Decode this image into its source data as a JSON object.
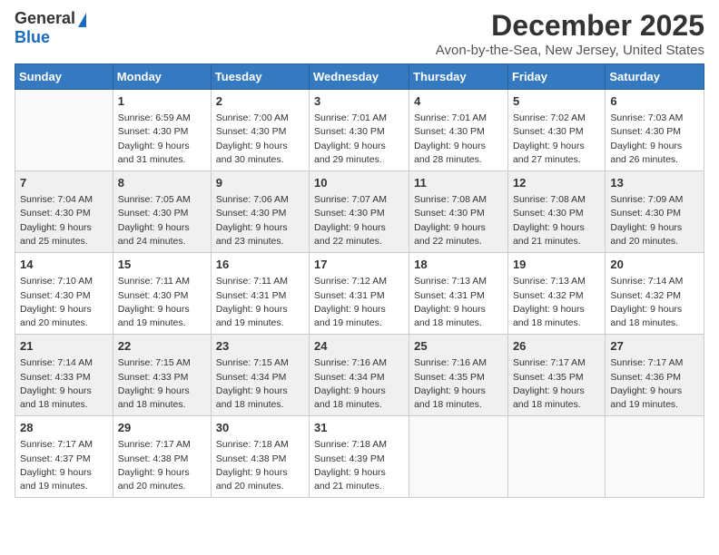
{
  "logo": {
    "line1": "General",
    "line2": "Blue"
  },
  "title": "December 2025",
  "subtitle": "Avon-by-the-Sea, New Jersey, United States",
  "days_of_week": [
    "Sunday",
    "Monday",
    "Tuesday",
    "Wednesday",
    "Thursday",
    "Friday",
    "Saturday"
  ],
  "weeks": [
    [
      {
        "day": "",
        "sunrise": "",
        "sunset": "",
        "daylight": ""
      },
      {
        "day": "1",
        "sunrise": "Sunrise: 6:59 AM",
        "sunset": "Sunset: 4:30 PM",
        "daylight": "Daylight: 9 hours and 31 minutes."
      },
      {
        "day": "2",
        "sunrise": "Sunrise: 7:00 AM",
        "sunset": "Sunset: 4:30 PM",
        "daylight": "Daylight: 9 hours and 30 minutes."
      },
      {
        "day": "3",
        "sunrise": "Sunrise: 7:01 AM",
        "sunset": "Sunset: 4:30 PM",
        "daylight": "Daylight: 9 hours and 29 minutes."
      },
      {
        "day": "4",
        "sunrise": "Sunrise: 7:01 AM",
        "sunset": "Sunset: 4:30 PM",
        "daylight": "Daylight: 9 hours and 28 minutes."
      },
      {
        "day": "5",
        "sunrise": "Sunrise: 7:02 AM",
        "sunset": "Sunset: 4:30 PM",
        "daylight": "Daylight: 9 hours and 27 minutes."
      },
      {
        "day": "6",
        "sunrise": "Sunrise: 7:03 AM",
        "sunset": "Sunset: 4:30 PM",
        "daylight": "Daylight: 9 hours and 26 minutes."
      }
    ],
    [
      {
        "day": "7",
        "sunrise": "Sunrise: 7:04 AM",
        "sunset": "Sunset: 4:30 PM",
        "daylight": "Daylight: 9 hours and 25 minutes."
      },
      {
        "day": "8",
        "sunrise": "Sunrise: 7:05 AM",
        "sunset": "Sunset: 4:30 PM",
        "daylight": "Daylight: 9 hours and 24 minutes."
      },
      {
        "day": "9",
        "sunrise": "Sunrise: 7:06 AM",
        "sunset": "Sunset: 4:30 PM",
        "daylight": "Daylight: 9 hours and 23 minutes."
      },
      {
        "day": "10",
        "sunrise": "Sunrise: 7:07 AM",
        "sunset": "Sunset: 4:30 PM",
        "daylight": "Daylight: 9 hours and 22 minutes."
      },
      {
        "day": "11",
        "sunrise": "Sunrise: 7:08 AM",
        "sunset": "Sunset: 4:30 PM",
        "daylight": "Daylight: 9 hours and 22 minutes."
      },
      {
        "day": "12",
        "sunrise": "Sunrise: 7:08 AM",
        "sunset": "Sunset: 4:30 PM",
        "daylight": "Daylight: 9 hours and 21 minutes."
      },
      {
        "day": "13",
        "sunrise": "Sunrise: 7:09 AM",
        "sunset": "Sunset: 4:30 PM",
        "daylight": "Daylight: 9 hours and 20 minutes."
      }
    ],
    [
      {
        "day": "14",
        "sunrise": "Sunrise: 7:10 AM",
        "sunset": "Sunset: 4:30 PM",
        "daylight": "Daylight: 9 hours and 20 minutes."
      },
      {
        "day": "15",
        "sunrise": "Sunrise: 7:11 AM",
        "sunset": "Sunset: 4:30 PM",
        "daylight": "Daylight: 9 hours and 19 minutes."
      },
      {
        "day": "16",
        "sunrise": "Sunrise: 7:11 AM",
        "sunset": "Sunset: 4:31 PM",
        "daylight": "Daylight: 9 hours and 19 minutes."
      },
      {
        "day": "17",
        "sunrise": "Sunrise: 7:12 AM",
        "sunset": "Sunset: 4:31 PM",
        "daylight": "Daylight: 9 hours and 19 minutes."
      },
      {
        "day": "18",
        "sunrise": "Sunrise: 7:13 AM",
        "sunset": "Sunset: 4:31 PM",
        "daylight": "Daylight: 9 hours and 18 minutes."
      },
      {
        "day": "19",
        "sunrise": "Sunrise: 7:13 AM",
        "sunset": "Sunset: 4:32 PM",
        "daylight": "Daylight: 9 hours and 18 minutes."
      },
      {
        "day": "20",
        "sunrise": "Sunrise: 7:14 AM",
        "sunset": "Sunset: 4:32 PM",
        "daylight": "Daylight: 9 hours and 18 minutes."
      }
    ],
    [
      {
        "day": "21",
        "sunrise": "Sunrise: 7:14 AM",
        "sunset": "Sunset: 4:33 PM",
        "daylight": "Daylight: 9 hours and 18 minutes."
      },
      {
        "day": "22",
        "sunrise": "Sunrise: 7:15 AM",
        "sunset": "Sunset: 4:33 PM",
        "daylight": "Daylight: 9 hours and 18 minutes."
      },
      {
        "day": "23",
        "sunrise": "Sunrise: 7:15 AM",
        "sunset": "Sunset: 4:34 PM",
        "daylight": "Daylight: 9 hours and 18 minutes."
      },
      {
        "day": "24",
        "sunrise": "Sunrise: 7:16 AM",
        "sunset": "Sunset: 4:34 PM",
        "daylight": "Daylight: 9 hours and 18 minutes."
      },
      {
        "day": "25",
        "sunrise": "Sunrise: 7:16 AM",
        "sunset": "Sunset: 4:35 PM",
        "daylight": "Daylight: 9 hours and 18 minutes."
      },
      {
        "day": "26",
        "sunrise": "Sunrise: 7:17 AM",
        "sunset": "Sunset: 4:35 PM",
        "daylight": "Daylight: 9 hours and 18 minutes."
      },
      {
        "day": "27",
        "sunrise": "Sunrise: 7:17 AM",
        "sunset": "Sunset: 4:36 PM",
        "daylight": "Daylight: 9 hours and 19 minutes."
      }
    ],
    [
      {
        "day": "28",
        "sunrise": "Sunrise: 7:17 AM",
        "sunset": "Sunset: 4:37 PM",
        "daylight": "Daylight: 9 hours and 19 minutes."
      },
      {
        "day": "29",
        "sunrise": "Sunrise: 7:17 AM",
        "sunset": "Sunset: 4:38 PM",
        "daylight": "Daylight: 9 hours and 20 minutes."
      },
      {
        "day": "30",
        "sunrise": "Sunrise: 7:18 AM",
        "sunset": "Sunset: 4:38 PM",
        "daylight": "Daylight: 9 hours and 20 minutes."
      },
      {
        "day": "31",
        "sunrise": "Sunrise: 7:18 AM",
        "sunset": "Sunset: 4:39 PM",
        "daylight": "Daylight: 9 hours and 21 minutes."
      },
      {
        "day": "",
        "sunrise": "",
        "sunset": "",
        "daylight": ""
      },
      {
        "day": "",
        "sunrise": "",
        "sunset": "",
        "daylight": ""
      },
      {
        "day": "",
        "sunrise": "",
        "sunset": "",
        "daylight": ""
      }
    ]
  ]
}
